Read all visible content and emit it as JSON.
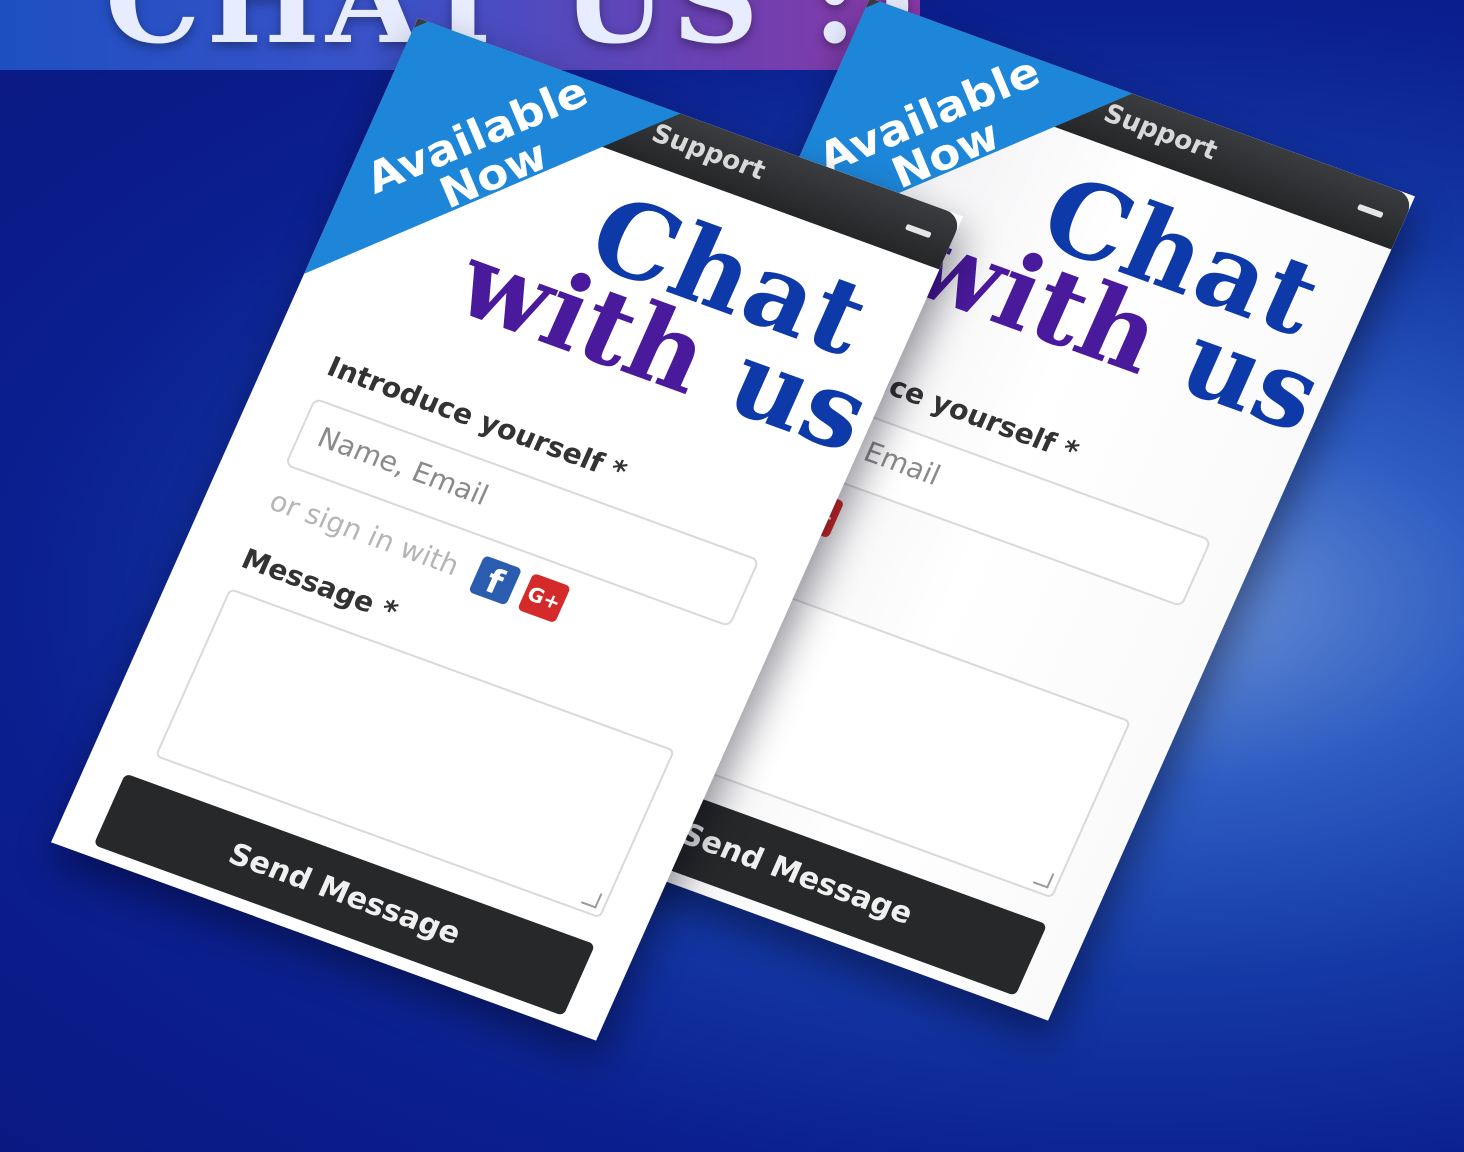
{
  "banner": {
    "headline": "CHAT US :)"
  },
  "widget": {
    "title": "Support",
    "ribbon": {
      "line1": "Available",
      "line2": "Now"
    },
    "hero": {
      "chat": "Chat",
      "with": "with",
      "us": "us"
    },
    "introduce_label": "Introduce yourself *",
    "name_email_placeholder": "Name, Email",
    "signin_text": "or sign in with",
    "facebook_icon_glyph": "f",
    "googleplus_icon_glyph": "G+",
    "message_label": "Message *",
    "send_button": "Send Message"
  },
  "colors": {
    "ribbon": "#1d86d8",
    "hero_blue": "#0d3aa8",
    "hero_purple": "#4a1a9c",
    "titlebar": "#2e3033",
    "send_button": "#262829",
    "facebook": "#2a5db0",
    "googleplus": "#d42a2a"
  }
}
